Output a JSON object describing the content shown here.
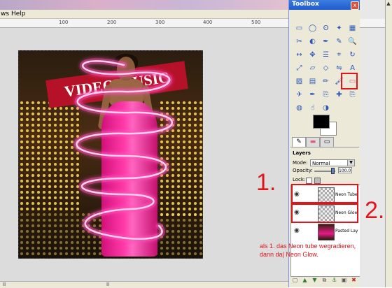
{
  "main_window": {
    "menu": {
      "windows_label": "ws",
      "help_label": "Help"
    },
    "ruler_labels": [
      "100",
      "200",
      "300",
      "400",
      "500"
    ],
    "hscroll_labels": [
      "II",
      "II"
    ]
  },
  "toolbox": {
    "title": "Toolbox",
    "close_label": "x",
    "layers_title": "Layers",
    "mode_label": "Mode:",
    "mode_value": "Normal",
    "opacity_label": "Opacity:",
    "opacity_value": "100.0",
    "lock_label": "Lock:",
    "layers": [
      {
        "name": "Neon Tube"
      },
      {
        "name": "Neon Glow"
      },
      {
        "name": "Pasted Lay"
      }
    ],
    "tools": [
      "rect-select",
      "ellipse-select",
      "lasso",
      "fuzzy-select",
      "color-select",
      "scissors",
      "foreground-select",
      "paths",
      "color-picker",
      "zoom",
      "measure",
      "move",
      "align",
      "crop",
      "rotate",
      "scale",
      "shear",
      "perspective",
      "flip",
      "text",
      "bucket-fill",
      "blend",
      "pencil",
      "paintbrush",
      "eraser",
      "airbrush",
      "ink",
      "clone",
      "heal",
      "perspective-clone",
      "blur",
      "smudge",
      "dodge-burn"
    ]
  },
  "annotations": {
    "number_1": "1.",
    "number_2": "2.",
    "note_line1": "als 1. das Neon tube wegradieren,",
    "note_line2": "dann da| Neon Glow."
  },
  "colors": {
    "highlight": "#e0141a",
    "neon": "#ff4fb8",
    "titlebar": "#1d5ad0"
  }
}
